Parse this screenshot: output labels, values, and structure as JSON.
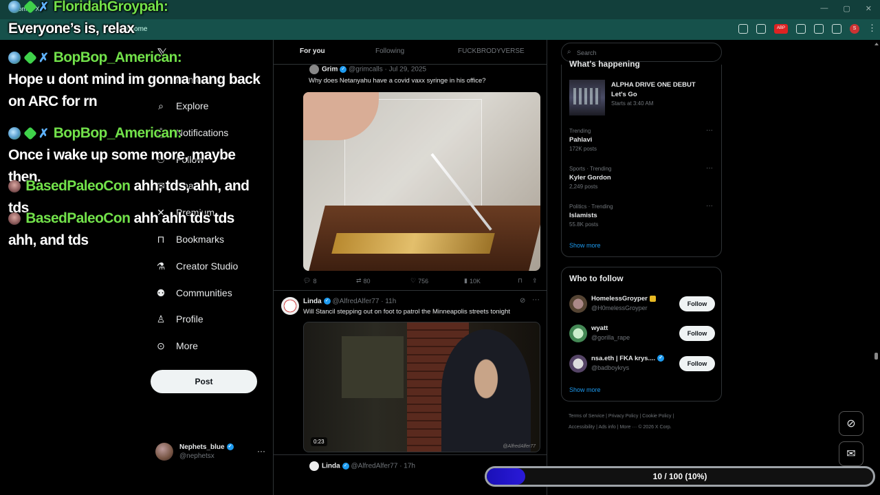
{
  "browser": {
    "tab_title": "Home / X",
    "address": "x.com/home",
    "win_controls": [
      "—",
      "▢",
      "✕"
    ],
    "ext_abp": "ABP",
    "ext_avatar": "S",
    "ext_menu": "⋮"
  },
  "nav": {
    "logo": "𝕏",
    "items": [
      {
        "label": "Home",
        "icon": "home-icon"
      },
      {
        "label": "Explore",
        "icon": "search-icon"
      },
      {
        "label": "Notifications",
        "icon": "bell-icon"
      },
      {
        "label": "Follow",
        "icon": "person-add-icon"
      },
      {
        "label": "Chat",
        "icon": "chat-icon"
      },
      {
        "label": "Premium",
        "icon": "x-icon"
      },
      {
        "label": "Bookmarks",
        "icon": "bookmark-icon"
      },
      {
        "label": "Creator Studio",
        "icon": "flask-icon"
      },
      {
        "label": "Communities",
        "icon": "people-icon"
      },
      {
        "label": "Profile",
        "icon": "person-icon"
      },
      {
        "label": "More",
        "icon": "more-circle-icon"
      }
    ],
    "post_button": "Post",
    "account": {
      "name": "Nephets_blue",
      "handle": "@nephetsx",
      "more": "···"
    }
  },
  "timeline": {
    "tabs": [
      {
        "label": "For you",
        "active": true
      },
      {
        "label": "Following",
        "active": false
      },
      {
        "label": "FUCKBRODYVERSE",
        "active": false
      }
    ],
    "tweets": [
      {
        "name": "Grim",
        "handle": "@grimcalls",
        "time": "· Jul 29, 2025",
        "text": "Why does Netanyahu have a covid vaxx syringe in his office?",
        "replies": "8",
        "reposts": "80",
        "likes": "756",
        "views": "10K"
      },
      {
        "name": "Linda",
        "handle": "@AlfredAlfer77",
        "time": "· 11h",
        "text": "Will Stancil stepping out on foot to patrol the Minneapolis streets tonight",
        "duration": "0:23",
        "watermark": "@AlfredAlfer77"
      },
      {
        "name": "Linda",
        "handle": "@AlfredAlfer77",
        "time": "· 17h"
      }
    ]
  },
  "right": {
    "search_placeholder": "Search",
    "happening_title": "What's happening",
    "promo": {
      "title": "ALPHA DRIVE ONE DEBUT",
      "subtitle": "Let's Go",
      "time": "Starts at 3:40 AM"
    },
    "trends": [
      {
        "category": "Trending",
        "name": "Pahlavi",
        "count": "172K posts"
      },
      {
        "category": "Sports · Trending",
        "name": "Kyler Gordon",
        "count": "2,249 posts"
      },
      {
        "category": "Politics · Trending",
        "name": "Islamists",
        "count": "55.8K posts"
      }
    ],
    "show_more": "Show more",
    "wtf_title": "Who to follow",
    "wtf": [
      {
        "name": "HomelessGroyper",
        "handle": "@H0melessGroyper",
        "button": "Follow"
      },
      {
        "name": "wyatt",
        "handle": "@gorilla_rape",
        "button": "Follow"
      },
      {
        "name": "nsa.eth | FKA krys....",
        "handle": "@badboykrys",
        "button": "Follow"
      }
    ],
    "footer": [
      "Terms of Service",
      "Privacy Policy",
      "Cookie Policy",
      "Accessibility",
      "Ads info",
      "More ···",
      "© 2026 X Corp."
    ]
  },
  "overlay_chat": [
    {
      "user": "FloridahGroypah:",
      "message": "Everyone’s is, relax"
    },
    {
      "user": "BopBop_American:",
      "message": "Hope u dont mind im gonna hang back on ARC for rn"
    },
    {
      "user": "BopBop_American:",
      "message": "Once i wake up some more, maybe then."
    },
    {
      "user": "BasedPaleoCon",
      "message": "ahh, tds, ahh, and tds"
    },
    {
      "user": "BasedPaleoCon",
      "message": "ahh ahh tds tds ahh, and tds"
    }
  ],
  "progress": {
    "label": "10 / 100 (10%)",
    "fraction": 0.1
  },
  "colors": {
    "accent": "#1d9bf0",
    "chat_user": "#72e14a",
    "progress_fill": "#2a1ad8",
    "chrome": "#16514b"
  }
}
